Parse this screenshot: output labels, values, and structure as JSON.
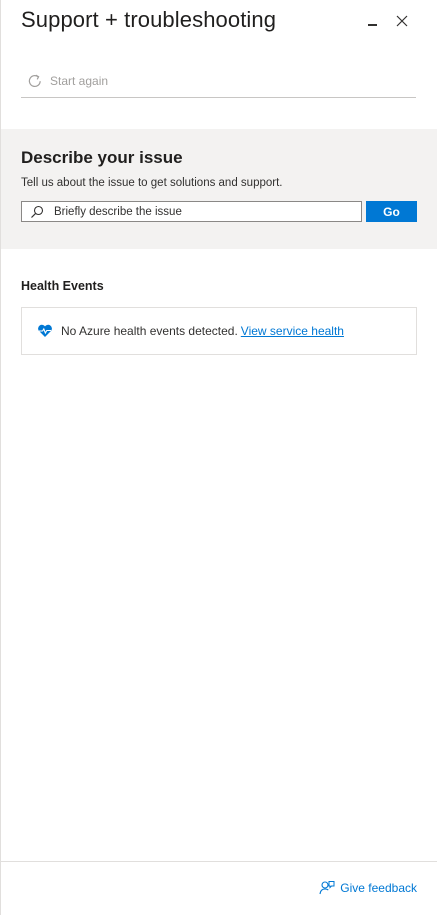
{
  "header": {
    "title": "Support + troubleshooting",
    "minimize_icon": "minimize-icon",
    "close_icon": "close-icon"
  },
  "toolbar": {
    "start_again_label": "Start again",
    "start_again_icon": "refresh-icon"
  },
  "describe_issue": {
    "title": "Describe your issue",
    "subtitle": "Tell us about the issue to get solutions and support.",
    "search_placeholder": "Briefly describe the issue",
    "search_value": "",
    "go_label": "Go"
  },
  "health_events": {
    "title": "Health Events",
    "message": "No Azure health events detected.",
    "link_label": "View service health",
    "icon": "heart-pulse-icon"
  },
  "footer": {
    "feedback_label": "Give feedback",
    "feedback_icon": "feedback-icon"
  },
  "colors": {
    "accent": "#0078d4",
    "section_bg": "#f3f2f1"
  }
}
